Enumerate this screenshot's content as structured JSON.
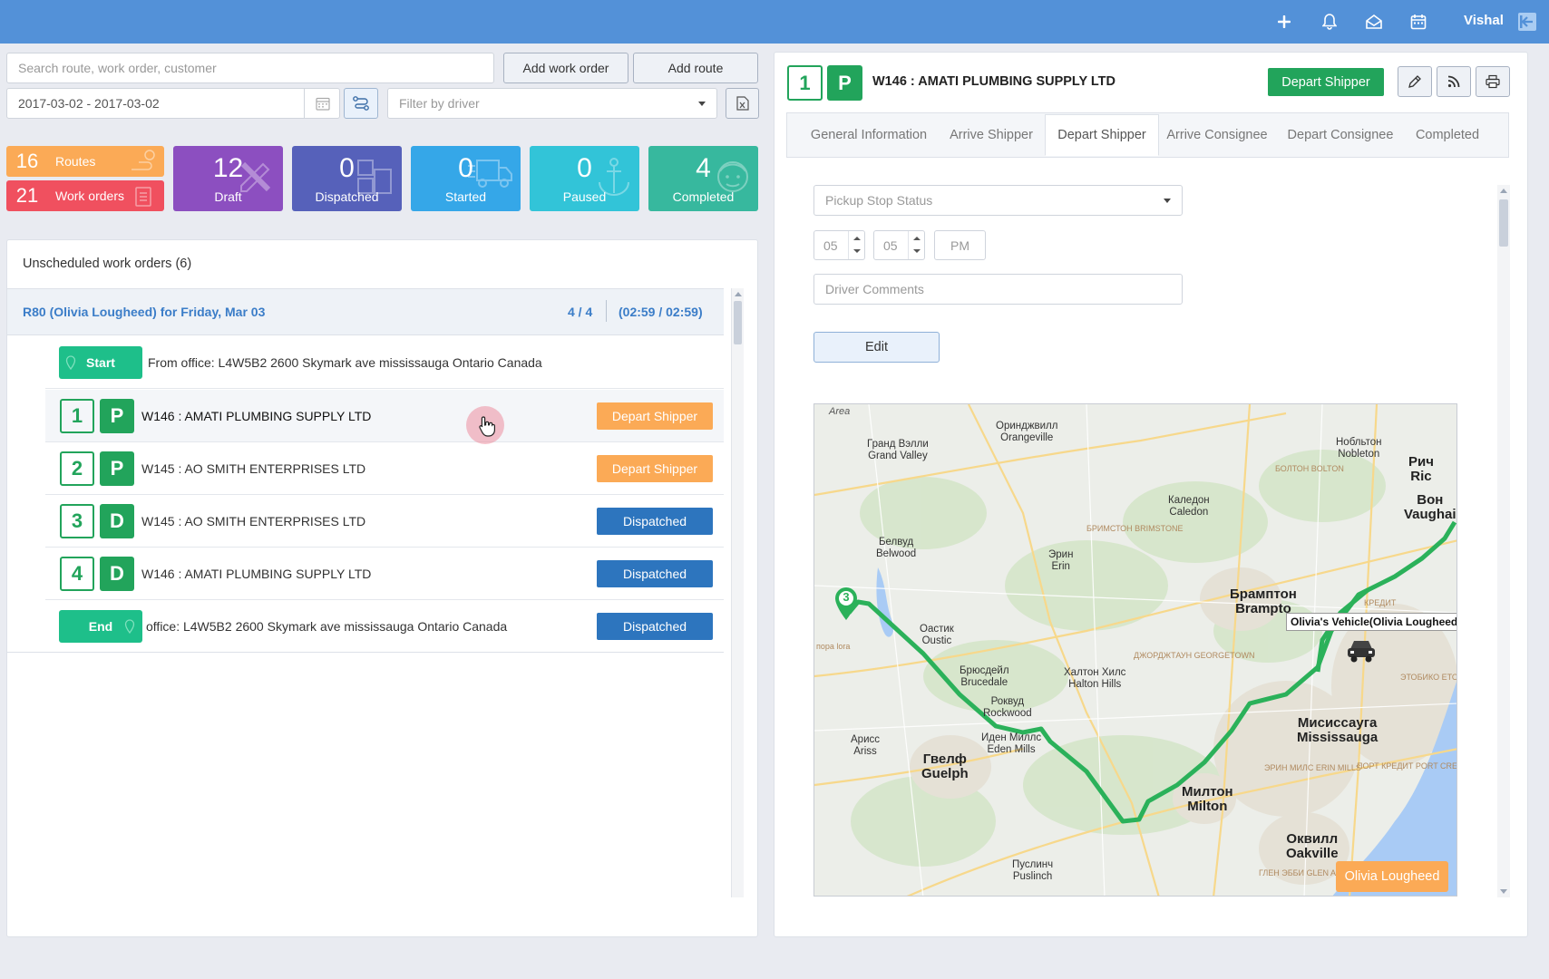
{
  "topbar": {
    "user": "Vishal",
    "icons": [
      "plus-icon",
      "bell-icon",
      "inbox-icon",
      "calendar-icon",
      "logout-icon"
    ]
  },
  "left": {
    "search_placeholder": "Search route, work order, customer",
    "add_work_order": "Add work order",
    "add_route": "Add route",
    "date_range": "2017-03-02 - 2017-03-02",
    "driver_filter_placeholder": "Filter by driver",
    "stats": {
      "routes": {
        "num": "16",
        "label": "Routes"
      },
      "work_orders": {
        "num": "21",
        "label": "Work orders"
      },
      "draft": {
        "num": "12",
        "label": "Draft"
      },
      "dispatched": {
        "num": "0",
        "label": "Dispatched"
      },
      "started": {
        "num": "0",
        "label": "Started"
      },
      "paused": {
        "num": "0",
        "label": "Paused"
      },
      "completed": {
        "num": "4",
        "label": "Completed"
      }
    },
    "unscheduled": "Unscheduled work orders (6)",
    "route": {
      "title": "R80 (Olivia Lougheed) for Friday, Mar 03",
      "count": "4 / 4",
      "time": "(02:59 / 02:59)",
      "start_label": "Start",
      "start_text": "From office: L4W5B2 2600 Skymark ave mississauga Ontario Canada",
      "end_label": "End",
      "end_text": "office: L4W5B2 2600 Skymark ave mississauga Ontario Canada",
      "end_status": "Dispatched",
      "stops": [
        {
          "num": "1",
          "type": "P",
          "text": "W146 : AMATI PLUMBING SUPPLY LTD",
          "status": "Depart Shipper"
        },
        {
          "num": "2",
          "type": "P",
          "text": "W145 : AO SMITH ENTERPRISES LTD",
          "status": "Depart Shipper"
        },
        {
          "num": "3",
          "type": "D",
          "text": "W145 : AO SMITH ENTERPRISES LTD",
          "status": "Dispatched"
        },
        {
          "num": "4",
          "type": "D",
          "text": "W146 : AMATI PLUMBING SUPPLY LTD",
          "status": "Dispatched"
        }
      ]
    }
  },
  "right": {
    "num": "1",
    "type": "P",
    "title": "W146 : AMATI PLUMBING SUPPLY LTD",
    "status_button": "Depart Shipper",
    "tabs": [
      "General Information",
      "Arrive Shipper",
      "Depart Shipper",
      "Arrive Consignee",
      "Depart Consignee",
      "Completed"
    ],
    "pickup_status_placeholder": "Pickup Stop Status",
    "hour": "05",
    "minute": "05",
    "ampm": "PM",
    "comments_placeholder": "Driver Comments",
    "edit_label": "Edit",
    "map": {
      "area_label": "Area",
      "vehicle_label": "Olivia's Vehicle(Olivia Lougheed",
      "driver_badge": "Olivia Lougheed",
      "marker": "3",
      "places": [
        {
          "ru": "Оринджвилл",
          "en": "Orangeville"
        },
        {
          "ru": "Гранд Вэлли",
          "en": "Grand Valley"
        },
        {
          "ru": "Калeдон",
          "en": "Caledon"
        },
        {
          "ru": "Нобльтон",
          "en": "Nobleton"
        },
        {
          "ru": "Рич",
          "en": "Ric"
        },
        {
          "ru": "Вон",
          "en": "Vaughai"
        },
        {
          "ru": "Белвуд",
          "en": "Belwood"
        },
        {
          "ru": "Эрин",
          "en": "Erin"
        },
        {
          "ru": "Брамптон",
          "en": "Brampto"
        },
        {
          "ru": "Оастик",
          "en": "Oustic"
        },
        {
          "ru": "Брюсдейл",
          "en": "Brucedale"
        },
        {
          "ru": "Халтон Хилс",
          "en": "Halton Hills"
        },
        {
          "ru": "Роквуд",
          "en": "Rockwood"
        },
        {
          "ru": "Иден Миллс",
          "en": "Eden Mills"
        },
        {
          "ru": "Мисиссауга",
          "en": "Mississauga"
        },
        {
          "ru": "Арисс",
          "en": "Ariss"
        },
        {
          "ru": "Гвелф",
          "en": "Guelph"
        },
        {
          "ru": "Милтон",
          "en": "Milton"
        },
        {
          "ru": "Оквилл",
          "en": "Oakville"
        },
        {
          "ru": "Пуслинч",
          "en": "Puslinch"
        }
      ],
      "minor_labels": [
        "БОЛТОН BOLTON",
        "БРИМСТОН BRIMSTONE",
        "ДЖОРДЖТАУН GEORGETOWN",
        "КРЕДИТ",
        "ЭТОБИКО ETOBICOKE",
        "ЭРИН МИЛС ERIN MILLS",
        "ПОРТ КРЕДИТ PORT CREDIT",
        "ГЛЕН ЭББИ GLEN ABBEY",
        "пора lora"
      ]
    }
  }
}
